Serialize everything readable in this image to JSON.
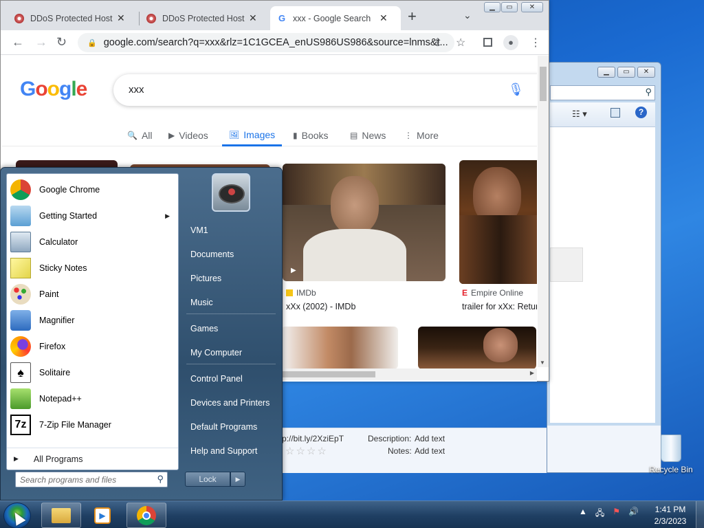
{
  "chrome": {
    "tabs": [
      {
        "title": "DDoS Protected Hostin",
        "close": "✕",
        "active": false
      },
      {
        "title": "DDoS Protected Hostin",
        "close": "✕",
        "active": false
      },
      {
        "title": "xxx - Google Search",
        "close": "✕",
        "active": true
      }
    ],
    "new_tab": "+",
    "url": "google.com/search?q=xxx&rlz=1C1GCEA_enUS986US986&source=lnms&t..."
  },
  "google": {
    "logo_letters": [
      "G",
      "o",
      "o",
      "g",
      "l",
      "e"
    ],
    "logo_colors": [
      "#4285f4",
      "#ea4335",
      "#fbbc05",
      "#4285f4",
      "#34a853",
      "#ea4335"
    ],
    "query": "xxx",
    "tabs": [
      {
        "label": "All",
        "icon": "search-icon"
      },
      {
        "label": "Videos",
        "icon": "video-icon"
      },
      {
        "label": "Images",
        "icon": "image-icon"
      },
      {
        "label": "Books",
        "icon": "book-icon"
      },
      {
        "label": "News",
        "icon": "news-icon"
      },
      {
        "label": "More",
        "icon": "more-icon"
      }
    ],
    "results": [
      {
        "source": "IMDb",
        "caption": "xXx (2002) - IMDb",
        "source_color": "#f5c518"
      },
      {
        "source": "Empire Online",
        "caption": "trailer for xXx: Retur",
        "source_color": "#e4202b"
      }
    ]
  },
  "explorer": {
    "details": [
      {
        "label": "p://bit.ly/2XziEpT"
      },
      {
        "label": "Description:",
        "value": "Add text"
      },
      {
        "label": "Notes:",
        "value": "Add text"
      }
    ]
  },
  "startmenu": {
    "programs": [
      {
        "label": "Google Chrome",
        "icon": "chrome-icon",
        "submenu": false
      },
      {
        "label": "Getting Started",
        "icon": "getting-started-icon",
        "submenu": true
      },
      {
        "label": "Calculator",
        "icon": "calculator-icon",
        "submenu": false
      },
      {
        "label": "Sticky Notes",
        "icon": "sticky-notes-icon",
        "submenu": false
      },
      {
        "label": "Paint",
        "icon": "paint-icon",
        "submenu": false
      },
      {
        "label": "Magnifier",
        "icon": "magnifier-icon",
        "submenu": false
      },
      {
        "label": "Firefox",
        "icon": "firefox-icon",
        "submenu": false
      },
      {
        "label": "Solitaire",
        "icon": "solitaire-icon",
        "submenu": false
      },
      {
        "label": "Notepad++",
        "icon": "notepadpp-icon",
        "submenu": false
      },
      {
        "label": "7-Zip File Manager",
        "icon": "7zip-icon",
        "submenu": false
      }
    ],
    "all_programs": "All Programs",
    "search_placeholder": "Search programs and files",
    "right_items": [
      "VM1",
      "Documents",
      "Pictures",
      "Music",
      "Games",
      "My Computer",
      "Control Panel",
      "Devices and Printers",
      "Default Programs",
      "Help and Support"
    ],
    "lock_label": "Lock"
  },
  "taskbar": {
    "time": "1:41 PM",
    "date": "2/3/2023"
  },
  "desktop": {
    "recycle_bin": "Recycle Bin"
  }
}
